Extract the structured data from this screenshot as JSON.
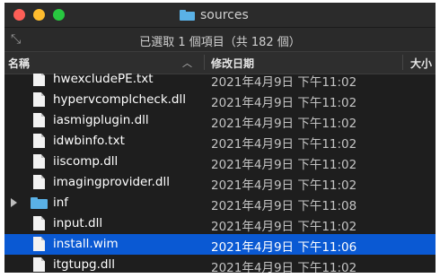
{
  "window": {
    "title": "sources",
    "status": "已選取 1 個項目（共 182 個）"
  },
  "columns": {
    "name": "名稱",
    "date": "修改日期",
    "size": "大小"
  },
  "files": [
    {
      "name": "hwexcludePE.txt",
      "date": "2021年4月9日 下午11:02",
      "kind": "file",
      "selected": false
    },
    {
      "name": "hypervcomplcheck.dll",
      "date": "2021年4月9日 下午11:02",
      "kind": "file",
      "selected": false
    },
    {
      "name": "iasmigplugin.dll",
      "date": "2021年4月9日 下午11:02",
      "kind": "file",
      "selected": false
    },
    {
      "name": "idwbinfo.txt",
      "date": "2021年4月9日 下午11:02",
      "kind": "file",
      "selected": false
    },
    {
      "name": "iiscomp.dll",
      "date": "2021年4月9日 下午11:02",
      "kind": "file",
      "selected": false
    },
    {
      "name": "imagingprovider.dll",
      "date": "2021年4月9日 下午11:02",
      "kind": "file",
      "selected": false
    },
    {
      "name": "inf",
      "date": "2021年4月9日 下午11:08",
      "kind": "folder",
      "selected": false
    },
    {
      "name": "input.dll",
      "date": "2021年4月9日 下午11:02",
      "kind": "file",
      "selected": false
    },
    {
      "name": "install.wim",
      "date": "2021年4月9日 下午11:06",
      "kind": "file",
      "selected": true
    },
    {
      "name": "itgtupg.dll",
      "date": "2021年4月9日 下午11:02",
      "kind": "file",
      "selected": false
    }
  ],
  "colors": {
    "selection": "#0a59d3",
    "folder": "#5ab1e6",
    "background": "#1e1e1e"
  }
}
